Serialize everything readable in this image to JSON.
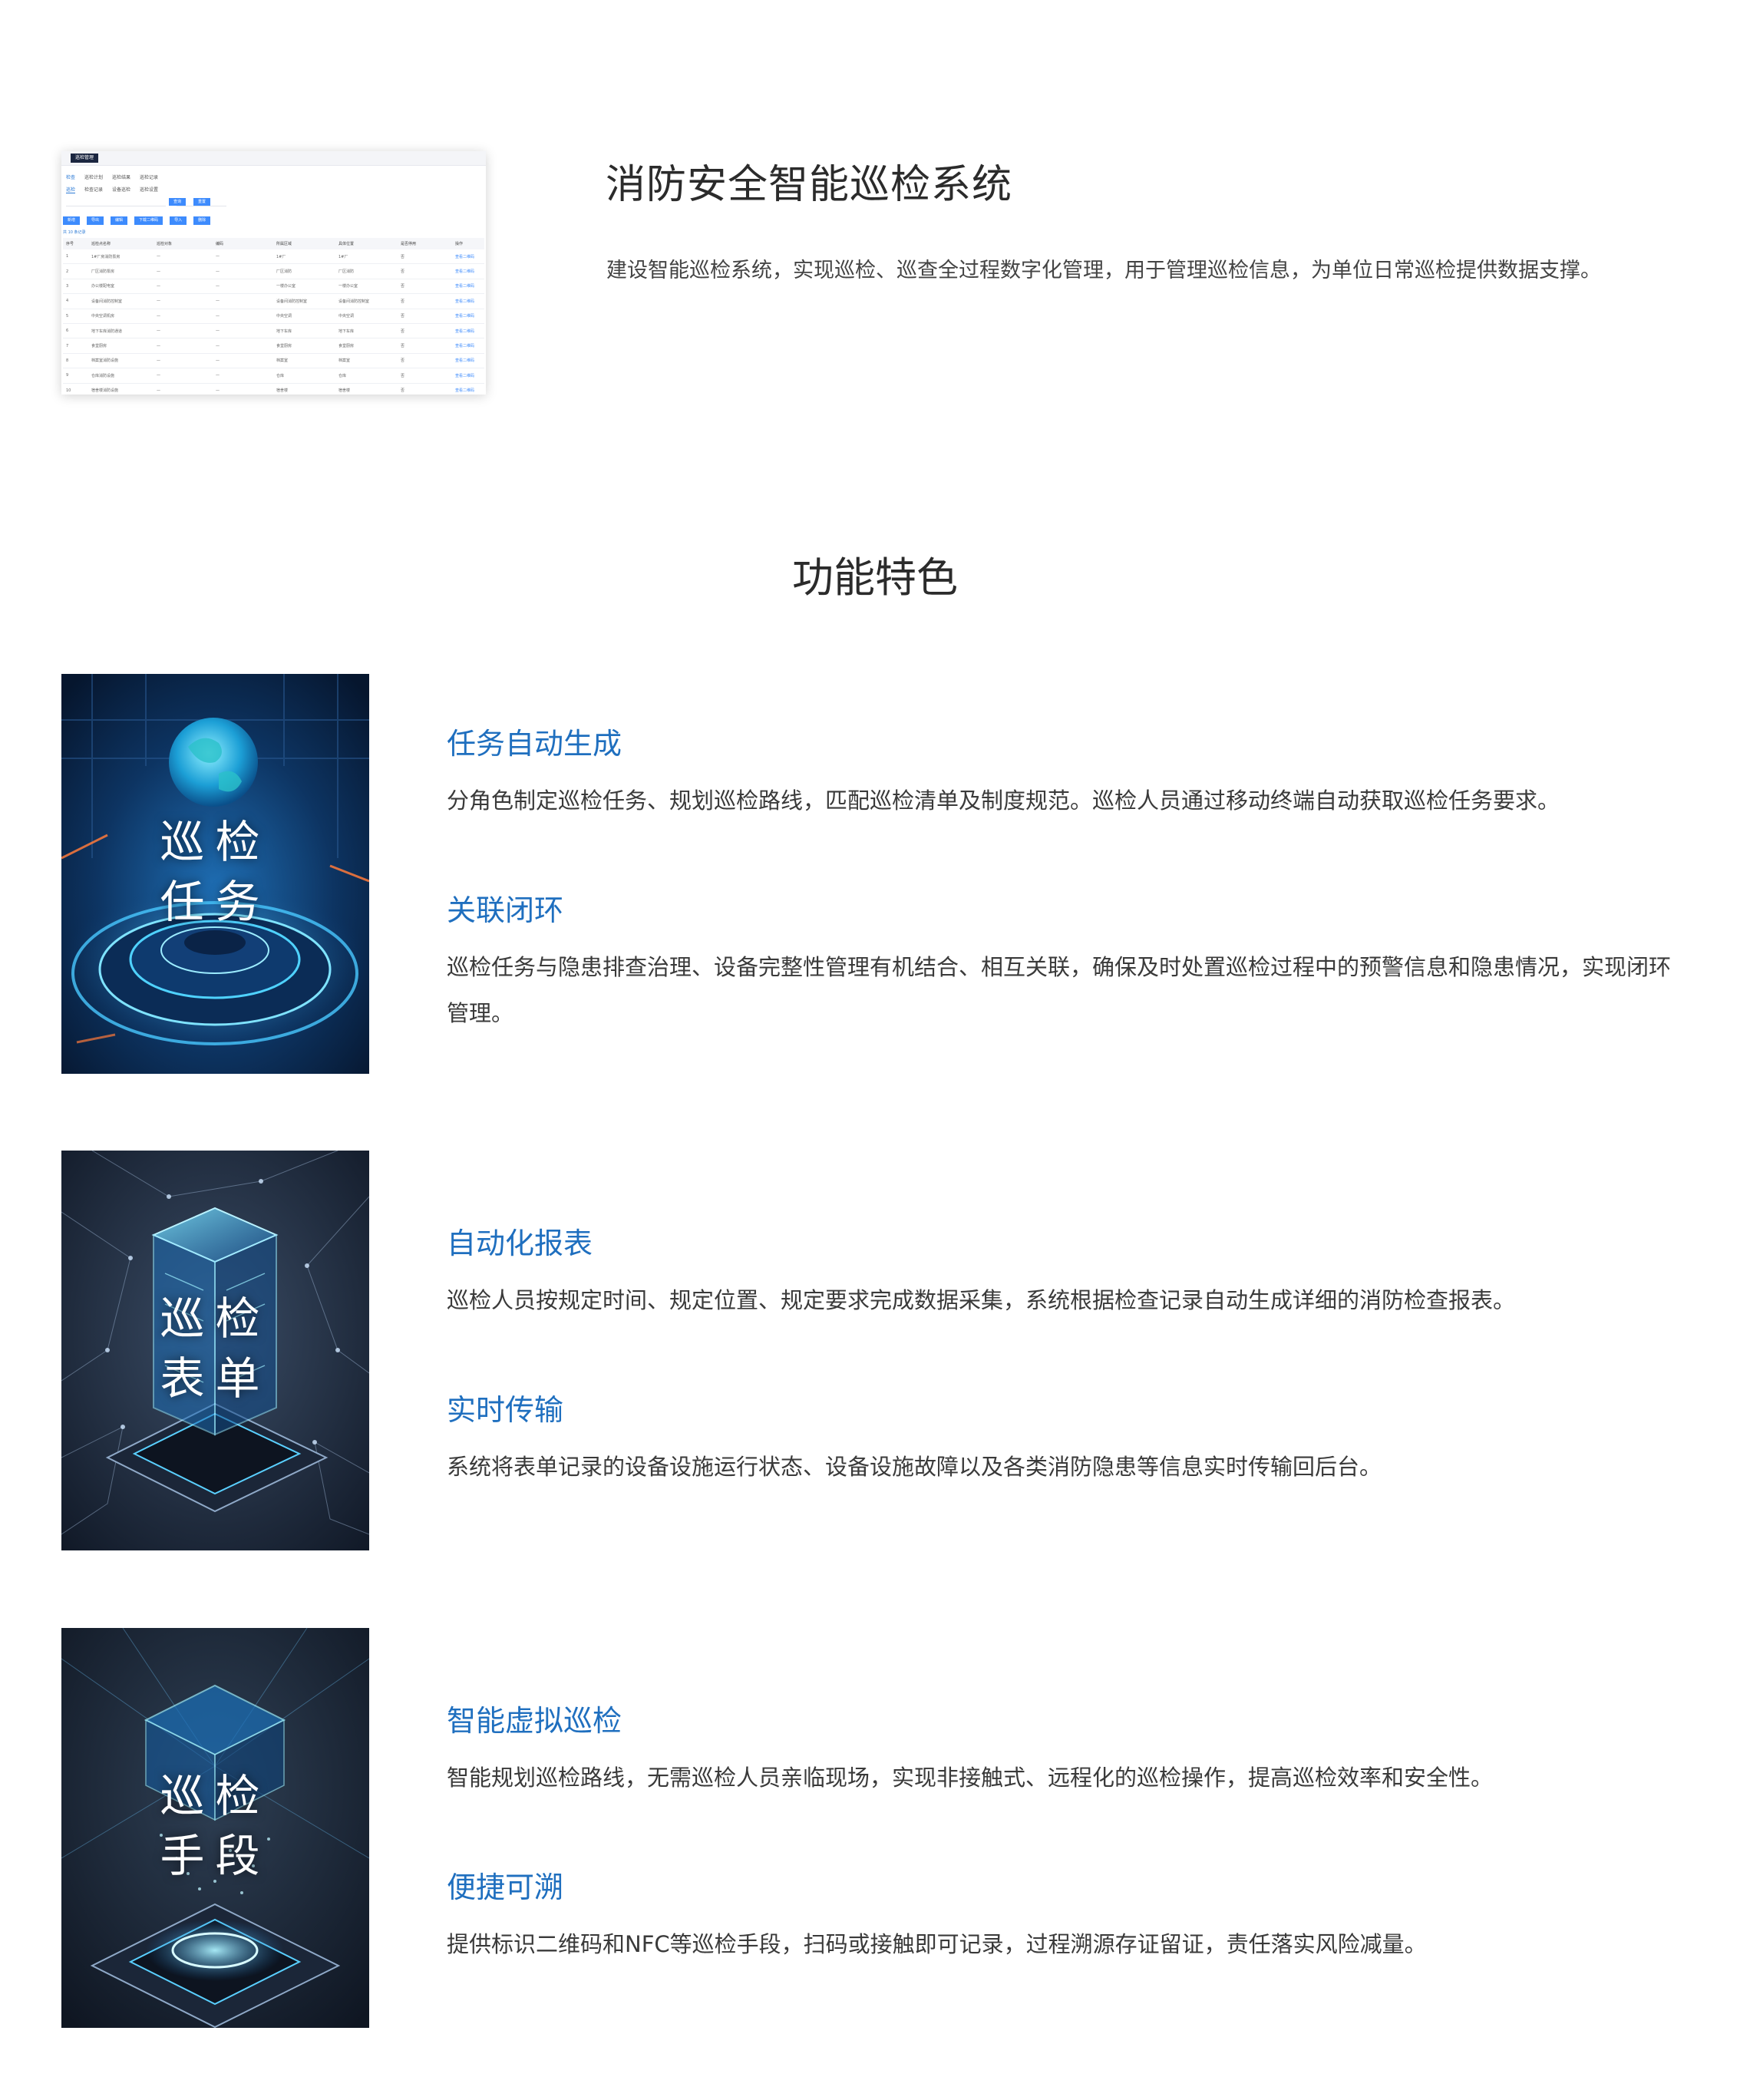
{
  "intro": {
    "title": "消防安全智能巡检系统",
    "description": "建设智能巡检系统，实现巡检、巡查全过程数字化管理，用于管理巡检信息，为单位日常巡检提供数据支撑。"
  },
  "screenshot_preview": {
    "brand": "巡检管理",
    "tabs": [
      "检查",
      "巡检计划",
      "巡检结果",
      "巡检记录"
    ],
    "subtabs": [
      "巡检",
      "检查记录",
      "设备巡检",
      "巡检设置"
    ],
    "filter_buttons": [
      "查询",
      "重置"
    ],
    "action_buttons": [
      "新增",
      "导出",
      "编辑",
      "下载二维码",
      "导入",
      "删除"
    ],
    "hint": "共 10 条记录",
    "columns": [
      "序号",
      "巡检点名称",
      "巡检对象",
      "编码",
      "所属区域",
      "具体位置",
      "是否停用",
      "操作"
    ],
    "rows": [
      [
        "1",
        "1#厂房消防泵房",
        "—",
        "—",
        "1#厂",
        "1#厂",
        "否",
        "查看二维码"
      ],
      [
        "2",
        "厂区消防泵房",
        "—",
        "—",
        "厂区消防",
        "厂区消防",
        "否",
        "查看二维码"
      ],
      [
        "3",
        "办公楼配电室",
        "—",
        "—",
        "一楼办公室",
        "一楼办公室",
        "否",
        "查看二维码"
      ],
      [
        "4",
        "设备间消防控制室",
        "—",
        "—",
        "设备间消防控制室",
        "设备间消防控制室",
        "否",
        "查看二维码"
      ],
      [
        "5",
        "中央空调机房",
        "—",
        "—",
        "中央空调",
        "中央空调",
        "否",
        "查看二维码"
      ],
      [
        "6",
        "地下车库消防通道",
        "—",
        "—",
        "地下车库",
        "地下车库",
        "否",
        "查看二维码"
      ],
      [
        "7",
        "食堂厨房",
        "—",
        "—",
        "食堂厨房",
        "食堂厨房",
        "否",
        "查看二维码"
      ],
      [
        "8",
        "档案室消防设施",
        "—",
        "—",
        "档案室",
        "档案室",
        "否",
        "查看二维码"
      ],
      [
        "9",
        "仓库消防设施",
        "—",
        "—",
        "仓库",
        "仓库",
        "否",
        "查看二维码"
      ],
      [
        "10",
        "宿舍楼消防设施",
        "—",
        "—",
        "宿舍楼",
        "宿舍楼",
        "否",
        "查看二维码"
      ]
    ]
  },
  "features_heading": "功能特色",
  "features": [
    {
      "image_label_line1": "巡检",
      "image_label_line2": "任务",
      "items": [
        {
          "title": "任务自动生成",
          "desc": "分角色制定巡检任务、规划巡检路线，匹配巡检清单及制度规范。巡检人员通过移动终端自动获取巡检任务要求。"
        },
        {
          "title": "关联闭环",
          "desc": "巡检任务与隐患排查治理、设备完整性管理有机结合、相互关联，确保及时处置巡检过程中的预警信息和隐患情况，实现闭环管理。"
        }
      ]
    },
    {
      "image_label_line1": "巡检",
      "image_label_line2": "表单",
      "items": [
        {
          "title": "自动化报表",
          "desc": "巡检人员按规定时间、规定位置、规定要求完成数据采集，系统根据检查记录自动生成详细的消防检查报表。"
        },
        {
          "title": "实时传输",
          "desc": "系统将表单记录的设备设施运行状态、设备设施故障以及各类消防隐患等信息实时传输回后台。"
        }
      ]
    },
    {
      "image_label_line1": "巡检",
      "image_label_line2": "手段",
      "items": [
        {
          "title": "智能虚拟巡检",
          "desc": "智能规划巡检路线，无需巡检人员亲临现场，实现非接触式、远程化的巡检操作，提高巡检效率和安全性。"
        },
        {
          "title": "便捷可溯",
          "desc": "提供标识二维码和NFC等巡检手段，扫码或接触即可记录，过程溯源存证留证，责任落实风险减量。"
        }
      ]
    }
  ]
}
